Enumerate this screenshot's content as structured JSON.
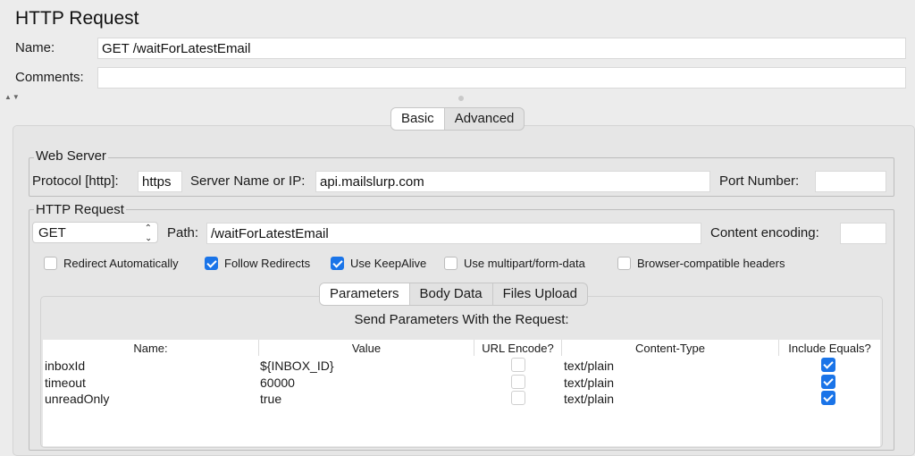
{
  "title": "HTTP Request",
  "name": {
    "label": "Name:",
    "value": "GET /waitForLatestEmail"
  },
  "comments": {
    "label": "Comments:",
    "value": ""
  },
  "main_tabs": [
    {
      "label": "Basic",
      "active": true
    },
    {
      "label": "Advanced",
      "active": false
    }
  ],
  "web_server": {
    "title": "Web Server",
    "protocol_label": "Protocol [http]:",
    "protocol_value": "https",
    "server_label": "Server Name or IP:",
    "server_value": "api.mailslurp.com",
    "port_label": "Port Number:",
    "port_value": ""
  },
  "http_request": {
    "title": "HTTP Request",
    "method": "GET",
    "path_label": "Path:",
    "path_value": "/waitForLatestEmail",
    "encoding_label": "Content encoding:",
    "encoding_value": "",
    "options": [
      {
        "label": "Redirect Automatically",
        "checked": false
      },
      {
        "label": "Follow Redirects",
        "checked": true
      },
      {
        "label": "Use KeepAlive",
        "checked": true
      },
      {
        "label": "Use multipart/form-data",
        "checked": false
      },
      {
        "label": "Browser-compatible headers",
        "checked": false
      }
    ]
  },
  "sub_tabs": [
    {
      "label": "Parameters",
      "active": true
    },
    {
      "label": "Body Data",
      "active": false
    },
    {
      "label": "Files Upload",
      "active": false
    }
  ],
  "params": {
    "heading": "Send Parameters With the Request:",
    "columns": [
      "Name:",
      "Value",
      "URL Encode?",
      "Content-Type",
      "Include Equals?"
    ],
    "rows": [
      {
        "name": "inboxId",
        "value": "${INBOX_ID}",
        "url_encode": false,
        "content_type": "text/plain",
        "include_equals": true
      },
      {
        "name": "timeout",
        "value": "60000",
        "url_encode": false,
        "content_type": "text/plain",
        "include_equals": true
      },
      {
        "name": "unreadOnly",
        "value": "true",
        "url_encode": false,
        "content_type": "text/plain",
        "include_equals": true
      }
    ]
  },
  "colors": {
    "accent": "#1a74e8",
    "background": "#ececec"
  }
}
